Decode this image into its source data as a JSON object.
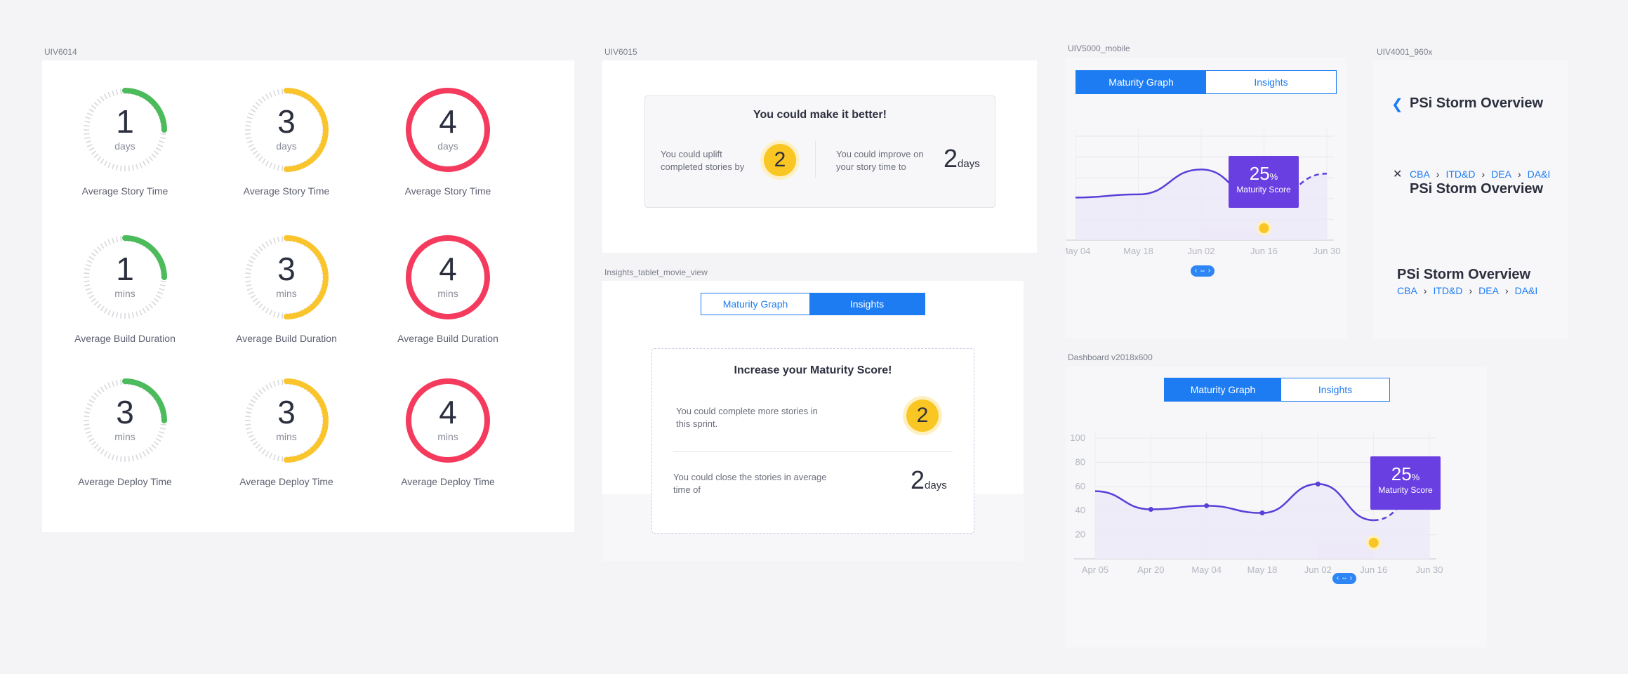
{
  "frames": {
    "uiv6014": "UIV6014",
    "uiv6015": "UIV6015",
    "tablet": "Insights_tablet_movie_view",
    "mobile": "UIV5000_mobile",
    "uiv4001": "UIV4001_960x",
    "dashboard": "Dashboard v2018x600"
  },
  "gauges": [
    {
      "value": "1",
      "unit": "days",
      "caption": "Average Story  Time",
      "color": "#4cbb5b",
      "fraction": 0.25
    },
    {
      "value": "3",
      "unit": "days",
      "caption": "Average Story  Time",
      "color": "#fac52c",
      "fraction": 0.5
    },
    {
      "value": "4",
      "unit": "days",
      "caption": "Average Story  Time",
      "color": "#f53b5d",
      "fraction": 1
    },
    {
      "value": "1",
      "unit": "mins",
      "caption": "Average Build Duration",
      "color": "#4cbb5b",
      "fraction": 0.25
    },
    {
      "value": "3",
      "unit": "mins",
      "caption": "Average Build Duration",
      "color": "#fac52c",
      "fraction": 0.5
    },
    {
      "value": "4",
      "unit": "mins",
      "caption": "Average Build Duration",
      "color": "#f53b5d",
      "fraction": 1
    },
    {
      "value": "3",
      "unit": "mins",
      "caption": "Average Deploy  Time",
      "color": "#4cbb5b",
      "fraction": 0.25
    },
    {
      "value": "3",
      "unit": "mins",
      "caption": "Average Deploy  Time",
      "color": "#fac52c",
      "fraction": 0.5
    },
    {
      "value": "4",
      "unit": "mins",
      "caption": "Average Deploy  Time",
      "color": "#f53b5d",
      "fraction": 1
    }
  ],
  "uiv6015": {
    "title": "You could make it better!",
    "uplift_text": "You could uplift completed  stories by",
    "uplift_value": "2",
    "improve_text": "You could improve on your story time to",
    "improve_value": "2",
    "improve_unit": "days"
  },
  "tablet": {
    "tab_graph": "Maturity Graph",
    "tab_insights": "Insights",
    "title": "Increase your Maturity Score!",
    "row1_text": "You could complete more stories in this sprint.",
    "row1_value": "2",
    "row2_text": "You could close the stories in average time of",
    "row2_value": "2",
    "row2_unit": "days"
  },
  "mobile": {
    "tab_graph": "Maturity Graph",
    "tab_insights": "Insights",
    "tooltip_value": "25",
    "tooltip_unit": "%",
    "tooltip_label": "Maturity Score"
  },
  "uiv4001": {
    "title1": "PSi Storm Overview",
    "crumbs": [
      "CBA",
      "ITD&D",
      "DEA",
      "DA&I"
    ],
    "title2": "PSi Storm Overview",
    "title3": "PSi Storm Overview"
  },
  "dashboard": {
    "tab_graph": "Maturity Graph",
    "tab_insights": "Insights",
    "tooltip_value": "25",
    "tooltip_unit": "%",
    "tooltip_label": "Maturity Score"
  },
  "colors": {
    "accent": "#1d7cf2",
    "line": "#5a3fd8",
    "tooltip": "#6a3fe2",
    "coin": "#f9c623"
  },
  "chart_data": [
    {
      "type": "line",
      "title": "",
      "categories": [
        "May 04",
        "May 18",
        "Jun 02",
        "Jun 16",
        "Jun 30"
      ],
      "yticks": [
        20,
        40,
        60,
        80,
        100
      ],
      "ylim": [
        0,
        100
      ],
      "series": [
        {
          "values": [
            41,
            44,
            68,
            35,
            64
          ],
          "dashed_from_index": 3
        }
      ],
      "highlight": {
        "category": "Jun 16",
        "value": 25
      },
      "grid": true
    },
    {
      "type": "line",
      "title": "",
      "categories": [
        "Apr 05",
        "Apr 20",
        "May 04",
        "May 18",
        "Jun 02",
        "Jun 16",
        "Jun 30"
      ],
      "yticks": [
        20,
        40,
        60,
        80,
        100
      ],
      "ylim": [
        0,
        100
      ],
      "series": [
        {
          "values": [
            56,
            41,
            44,
            38,
            62,
            32,
            60
          ],
          "dashed_from_index": 5
        }
      ],
      "highlight": {
        "category": "Jun 16",
        "value": 25
      },
      "grid": true
    }
  ]
}
